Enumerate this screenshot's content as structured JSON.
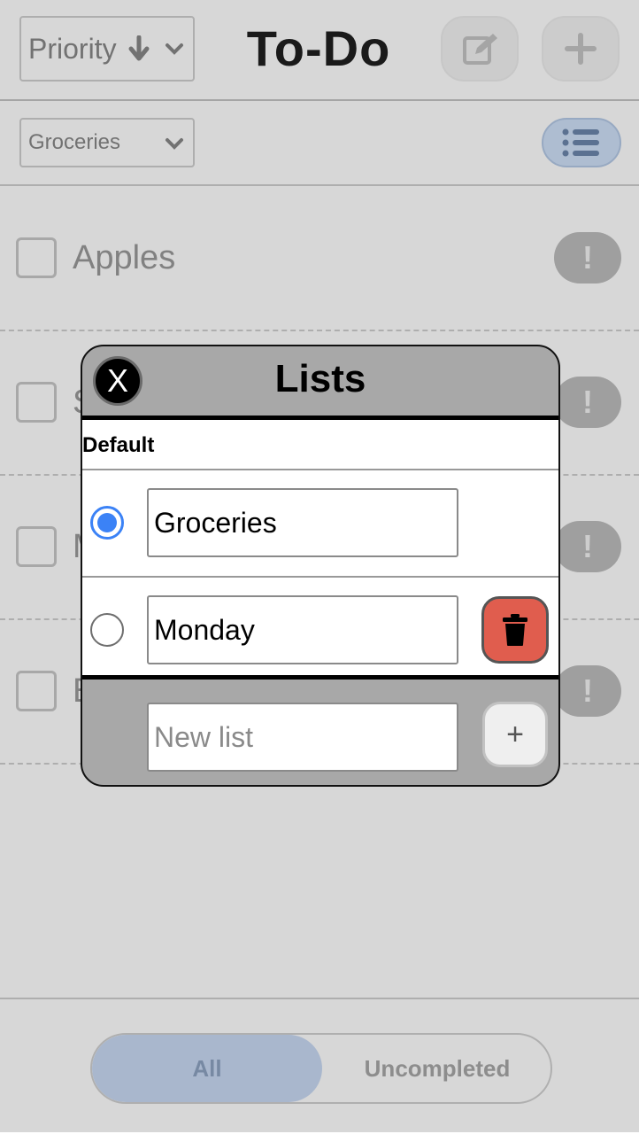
{
  "app": {
    "title": "To-Do",
    "sort": {
      "selected": "Priority",
      "arrow_icon": "arrow-down-icon"
    },
    "list_filter": {
      "selected": "Groceries"
    },
    "tasks": [
      {
        "label": "Apples",
        "priority": "!"
      },
      {
        "label": "S",
        "priority": "!"
      },
      {
        "label": "M",
        "priority": "!"
      },
      {
        "label": "E",
        "priority": "!"
      }
    ],
    "filters": {
      "all": "All",
      "uncompleted": "Uncompleted",
      "active": "All"
    }
  },
  "modal": {
    "title": "Lists",
    "close_label": "X",
    "section_label": "Default",
    "lists": [
      {
        "name": "Groceries",
        "selected": true,
        "deletable": false
      },
      {
        "name": "Monday",
        "selected": false,
        "deletable": true
      }
    ],
    "new_list_placeholder": "New list",
    "add_label": "+"
  },
  "colors": {
    "accent": "#3b82f6",
    "delete": "#e05d4e",
    "modal_bg": "#a8a8a8"
  }
}
